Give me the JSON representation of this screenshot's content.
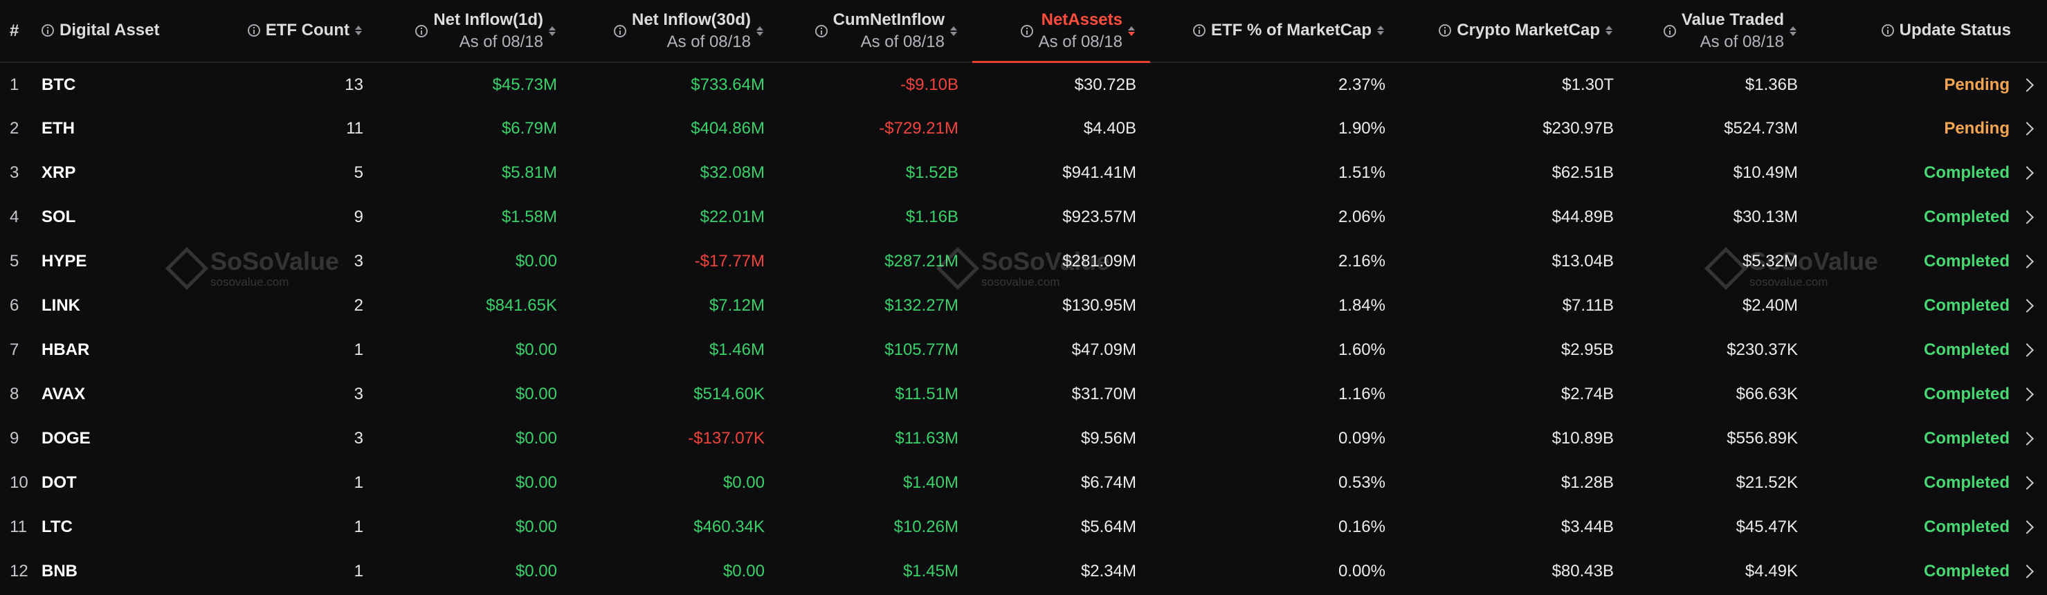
{
  "table": {
    "headers": {
      "index": "#",
      "asset": "Digital Asset",
      "etf_count": "ETF Count",
      "net_inflow_1d": "Net Inflow(1d)",
      "net_inflow_30d": "Net Inflow(30d)",
      "cum_net_inflow": "CumNetInflow",
      "net_assets": "NetAssets",
      "etf_pct_mcap": "ETF % of MarketCap",
      "crypto_mcap": "Crypto MarketCap",
      "value_traded": "Value Traded",
      "update_status": "Update Status",
      "as_of": "As of 08/18"
    },
    "active_sort": "net_assets",
    "rows": [
      {
        "index": "1",
        "asset": "BTC",
        "etf_count": "13",
        "net_inflow_1d": "$45.73M",
        "net_inflow_30d": "$733.64M",
        "cum_net_inflow": "-$9.10B",
        "net_assets": "$30.72B",
        "etf_pct_mcap": "2.37%",
        "crypto_mcap": "$1.30T",
        "value_traded": "$1.36B",
        "update_status": "Pending"
      },
      {
        "index": "2",
        "asset": "ETH",
        "etf_count": "11",
        "net_inflow_1d": "$6.79M",
        "net_inflow_30d": "$404.86M",
        "cum_net_inflow": "-$729.21M",
        "net_assets": "$4.40B",
        "etf_pct_mcap": "1.90%",
        "crypto_mcap": "$230.97B",
        "value_traded": "$524.73M",
        "update_status": "Pending"
      },
      {
        "index": "3",
        "asset": "XRP",
        "etf_count": "5",
        "net_inflow_1d": "$5.81M",
        "net_inflow_30d": "$32.08M",
        "cum_net_inflow": "$1.52B",
        "net_assets": "$941.41M",
        "etf_pct_mcap": "1.51%",
        "crypto_mcap": "$62.51B",
        "value_traded": "$10.49M",
        "update_status": "Completed"
      },
      {
        "index": "4",
        "asset": "SOL",
        "etf_count": "9",
        "net_inflow_1d": "$1.58M",
        "net_inflow_30d": "$22.01M",
        "cum_net_inflow": "$1.16B",
        "net_assets": "$923.57M",
        "etf_pct_mcap": "2.06%",
        "crypto_mcap": "$44.89B",
        "value_traded": "$30.13M",
        "update_status": "Completed"
      },
      {
        "index": "5",
        "asset": "HYPE",
        "etf_count": "3",
        "net_inflow_1d": "$0.00",
        "net_inflow_30d": "-$17.77M",
        "cum_net_inflow": "$287.21M",
        "net_assets": "$281.09M",
        "etf_pct_mcap": "2.16%",
        "crypto_mcap": "$13.04B",
        "value_traded": "$5.32M",
        "update_status": "Completed"
      },
      {
        "index": "6",
        "asset": "LINK",
        "etf_count": "2",
        "net_inflow_1d": "$841.65K",
        "net_inflow_30d": "$7.12M",
        "cum_net_inflow": "$132.27M",
        "net_assets": "$130.95M",
        "etf_pct_mcap": "1.84%",
        "crypto_mcap": "$7.11B",
        "value_traded": "$2.40M",
        "update_status": "Completed"
      },
      {
        "index": "7",
        "asset": "HBAR",
        "etf_count": "1",
        "net_inflow_1d": "$0.00",
        "net_inflow_30d": "$1.46M",
        "cum_net_inflow": "$105.77M",
        "net_assets": "$47.09M",
        "etf_pct_mcap": "1.60%",
        "crypto_mcap": "$2.95B",
        "value_traded": "$230.37K",
        "update_status": "Completed"
      },
      {
        "index": "8",
        "asset": "AVAX",
        "etf_count": "3",
        "net_inflow_1d": "$0.00",
        "net_inflow_30d": "$514.60K",
        "cum_net_inflow": "$11.51M",
        "net_assets": "$31.70M",
        "etf_pct_mcap": "1.16%",
        "crypto_mcap": "$2.74B",
        "value_traded": "$66.63K",
        "update_status": "Completed"
      },
      {
        "index": "9",
        "asset": "DOGE",
        "etf_count": "3",
        "net_inflow_1d": "$0.00",
        "net_inflow_30d": "-$137.07K",
        "cum_net_inflow": "$11.63M",
        "net_assets": "$9.56M",
        "etf_pct_mcap": "0.09%",
        "crypto_mcap": "$10.89B",
        "value_traded": "$556.89K",
        "update_status": "Completed"
      },
      {
        "index": "10",
        "asset": "DOT",
        "etf_count": "1",
        "net_inflow_1d": "$0.00",
        "net_inflow_30d": "$0.00",
        "cum_net_inflow": "$1.40M",
        "net_assets": "$6.74M",
        "etf_pct_mcap": "0.53%",
        "crypto_mcap": "$1.28B",
        "value_traded": "$21.52K",
        "update_status": "Completed"
      },
      {
        "index": "11",
        "asset": "LTC",
        "etf_count": "1",
        "net_inflow_1d": "$0.00",
        "net_inflow_30d": "$460.34K",
        "cum_net_inflow": "$10.26M",
        "net_assets": "$5.64M",
        "etf_pct_mcap": "0.16%",
        "crypto_mcap": "$3.44B",
        "value_traded": "$45.47K",
        "update_status": "Completed"
      },
      {
        "index": "12",
        "asset": "BNB",
        "etf_count": "1",
        "net_inflow_1d": "$0.00",
        "net_inflow_30d": "$0.00",
        "cum_net_inflow": "$1.45M",
        "net_assets": "$2.34M",
        "etf_pct_mcap": "0.00%",
        "crypto_mcap": "$80.43B",
        "value_traded": "$4.49K",
        "update_status": "Completed"
      }
    ]
  },
  "watermark": {
    "name": "SoSoValue",
    "domain": "sosovalue.com"
  },
  "colors": {
    "background": "#0d0d0f",
    "positive": "#3ad16a",
    "negative": "#f0433b",
    "active_sort": "#ff4d3d",
    "pending": "#f4a552",
    "completed": "#48d872"
  }
}
